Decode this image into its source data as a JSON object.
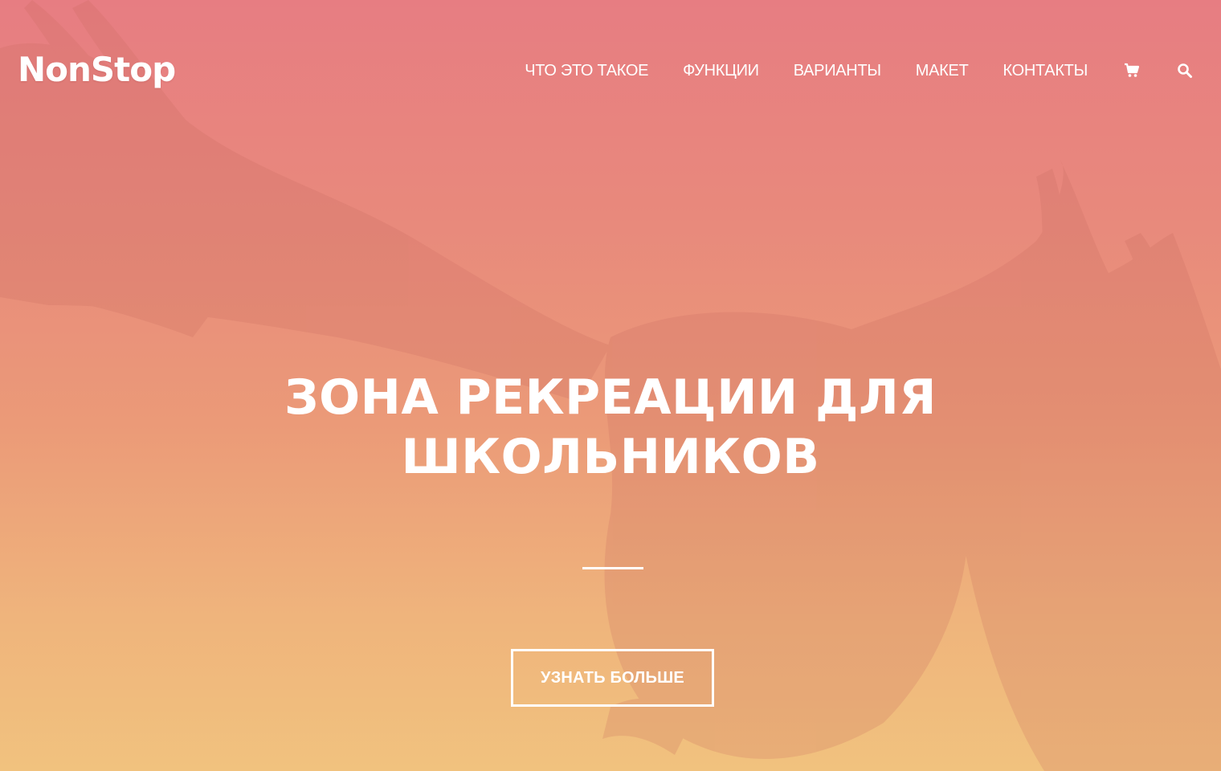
{
  "brand": {
    "logo_text": "NonStop"
  },
  "nav": {
    "items": [
      {
        "label": "ЧТО ЭТО ТАКОЕ"
      },
      {
        "label": "ФУНКЦИИ"
      },
      {
        "label": "ВАРИАНТЫ"
      },
      {
        "label": "МАКЕТ"
      },
      {
        "label": "КОНТАКТЫ"
      }
    ],
    "icons": [
      "cart-icon",
      "search-icon"
    ]
  },
  "hero": {
    "headline_line1": "ЗОНА РЕКРЕАЦИИ ДЛЯ",
    "headline_line2": "ШКОЛЬНИКОВ",
    "cta_label": "УЗНАТЬ БОЛЬШЕ",
    "background_image": "eagle-photo"
  },
  "colors": {
    "gradient_top": "#e77d82",
    "gradient_bottom": "#f1c27e",
    "text": "#ffffff"
  }
}
